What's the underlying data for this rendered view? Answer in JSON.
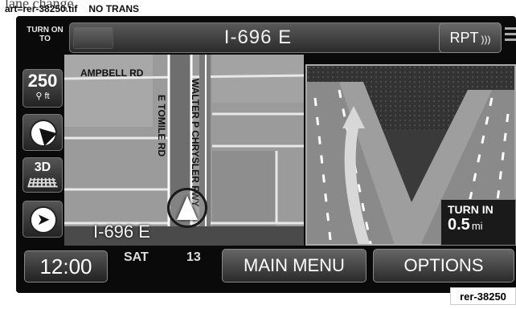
{
  "caption": {
    "top_text": "lane change.",
    "file_tag": "art=rer-38250.tif",
    "trans_tag": "NO TRANS"
  },
  "top_bar": {
    "turn_label": "TURN ON TO",
    "street_name": "I-696 E",
    "repeat_label": "RPT",
    "repeat_icon": "sound-waves-icon"
  },
  "map": {
    "streets": [
      "AMPBELL RD",
      "E TOMILE RD",
      "WALTER P CHRYSLER FWY"
    ],
    "current_road": "I-696 E",
    "vehicle_icon": "navigation-arrow-icon"
  },
  "left_toolbar": {
    "zoom_value": "250",
    "zoom_unit": "ft",
    "view_label": "3D",
    "compass_icon": "compass-icon",
    "destination_icon": "destination-flag-icon"
  },
  "junction": {
    "turn_in_label": "TURN IN",
    "distance": "0.5",
    "distance_unit": "mi"
  },
  "bottom_bar": {
    "time": "12:00",
    "day": "SAT",
    "date": "13",
    "main_menu_label": "MAIN MENU",
    "options_label": "OPTIONS"
  },
  "art_code": "rer-38250",
  "colors": {
    "screen_bg": "#0a0a0a",
    "map_bg": "#9b9b9b",
    "text": "#ffffff"
  }
}
